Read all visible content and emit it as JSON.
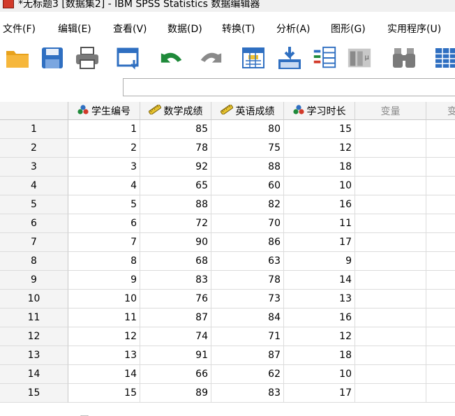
{
  "window": {
    "title": "*无标题3 [数据集2] - IBM SPSS Statistics 数据编辑器",
    "icon": "spss-app-icon"
  },
  "menu": [
    "文件(F)",
    "编辑(E)",
    "查看(V)",
    "数据(D)",
    "转换(T)",
    "分析(A)",
    "图形(G)",
    "实用程序(U)"
  ],
  "toolbar": [
    "open-folder-icon",
    "save-icon",
    "print-icon",
    "dialog-recall-icon",
    "undo-icon",
    "redo-icon",
    "goto-case-icon",
    "goto-variable-icon",
    "variables-icon",
    "run-descriptives-icon",
    "find-icon",
    "insert-cases-icon"
  ],
  "formula_bar": {
    "value": ""
  },
  "grid": {
    "columns": [
      {
        "label": "学生编号",
        "icon": "nominal-icon"
      },
      {
        "label": "数学成绩",
        "icon": "scale-icon"
      },
      {
        "label": "英语成绩",
        "icon": "scale-icon"
      },
      {
        "label": "学习时长",
        "icon": "nominal-icon"
      },
      {
        "label": "变量",
        "icon": ""
      },
      {
        "label": "变",
        "icon": ""
      }
    ],
    "rows": [
      [
        "1",
        "1",
        "85",
        "80",
        "15"
      ],
      [
        "2",
        "2",
        "78",
        "75",
        "12"
      ],
      [
        "3",
        "3",
        "92",
        "88",
        "18"
      ],
      [
        "4",
        "4",
        "65",
        "60",
        "10"
      ],
      [
        "5",
        "5",
        "88",
        "82",
        "16"
      ],
      [
        "6",
        "6",
        "72",
        "70",
        "11"
      ],
      [
        "7",
        "7",
        "90",
        "86",
        "17"
      ],
      [
        "8",
        "8",
        "68",
        "63",
        "9"
      ],
      [
        "9",
        "9",
        "83",
        "78",
        "14"
      ],
      [
        "10",
        "10",
        "76",
        "73",
        "13"
      ],
      [
        "11",
        "11",
        "87",
        "84",
        "16"
      ],
      [
        "12",
        "12",
        "74",
        "71",
        "12"
      ],
      [
        "13",
        "13",
        "91",
        "87",
        "18"
      ],
      [
        "14",
        "14",
        "66",
        "62",
        "10"
      ],
      [
        "15",
        "15",
        "89",
        "83",
        "17"
      ]
    ]
  }
}
